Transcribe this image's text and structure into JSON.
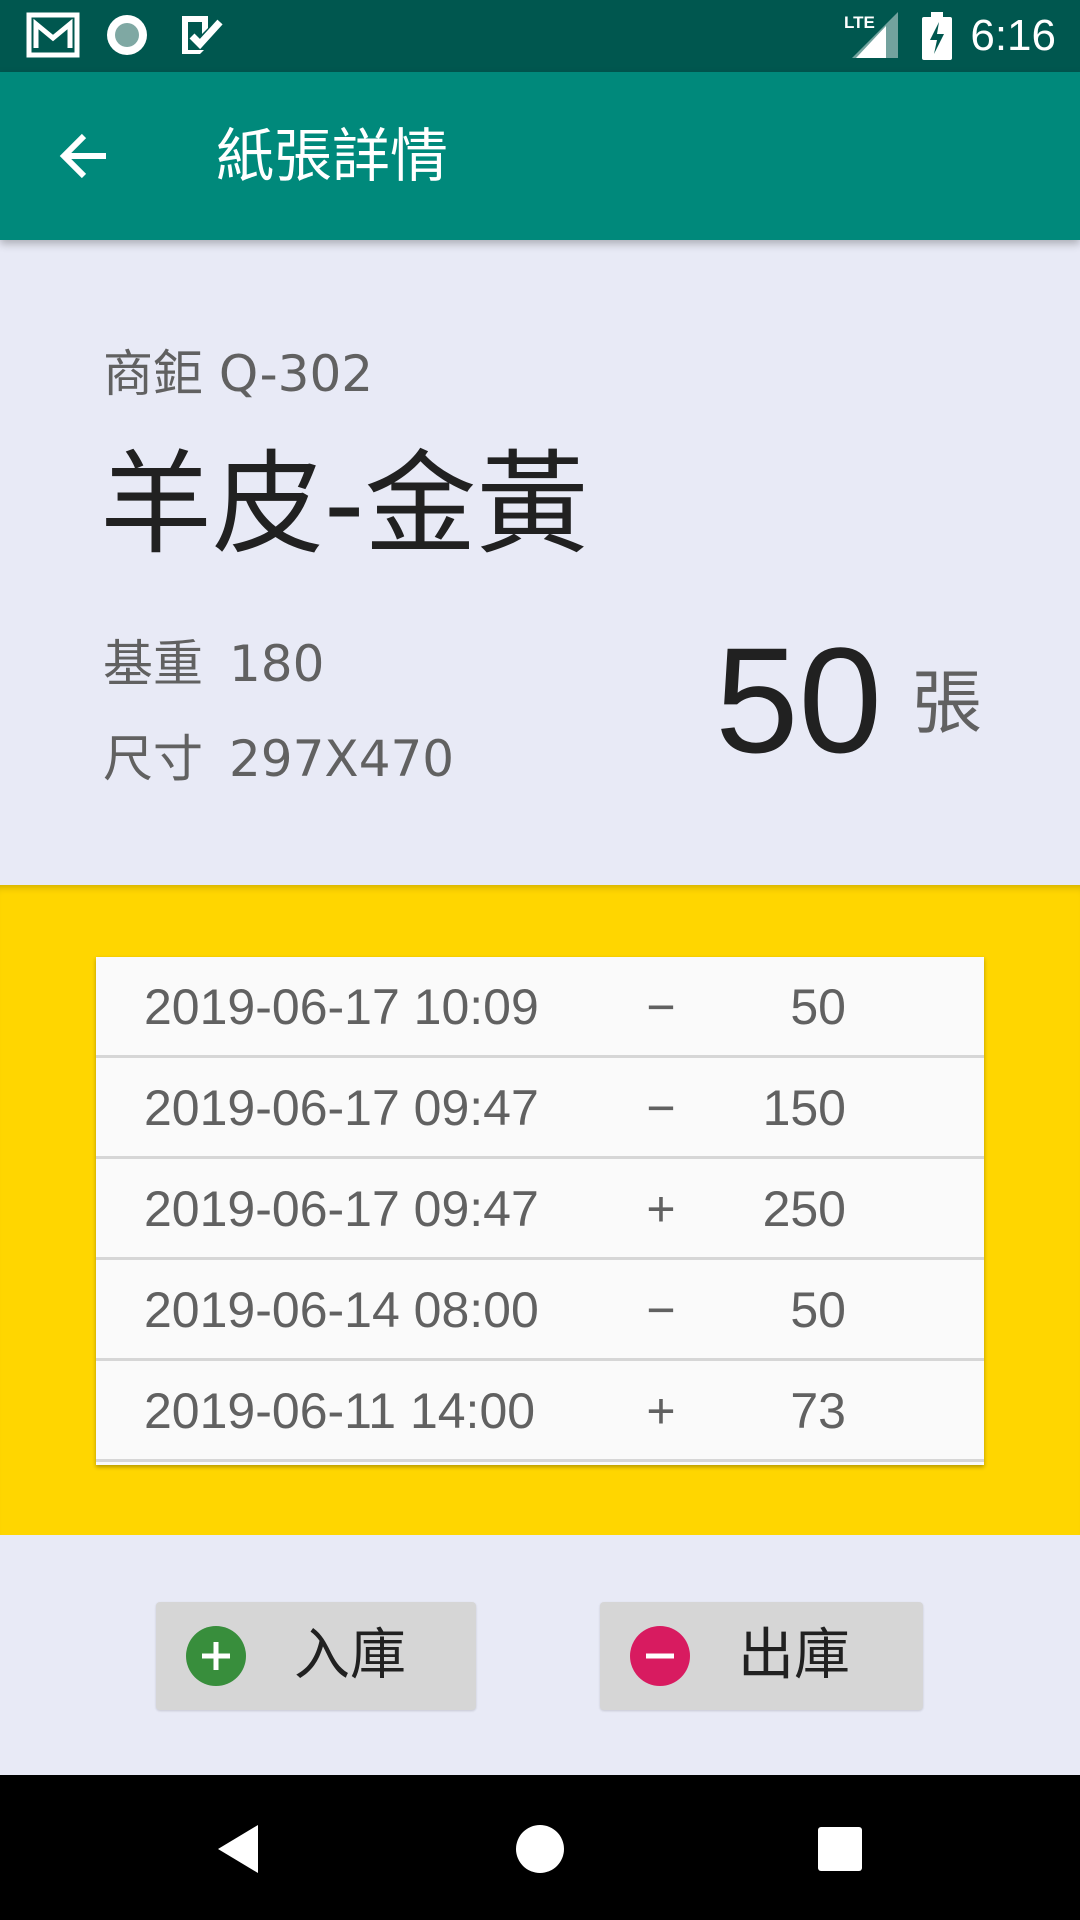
{
  "status_bar": {
    "time": "6:16",
    "network_label": "LTE",
    "icons": [
      "gmail-icon",
      "circle-app-icon",
      "checkmark-app-icon",
      "lte-signal-icon",
      "battery-charging-icon"
    ]
  },
  "app_bar": {
    "title": "紙張詳情",
    "back_icon": "arrow-left-icon"
  },
  "summary": {
    "supplier_code": "商鉅 Q-302",
    "paper_name": "羊皮-金黃",
    "weight_label": "基重",
    "weight_value": "180",
    "size_label": "尺寸",
    "size_value": "297X470",
    "stock_count": "50",
    "stock_unit": "張"
  },
  "history": {
    "rows": [
      {
        "date": "2019-06-17 10:09",
        "sign": "−",
        "qty": "50"
      },
      {
        "date": "2019-06-17 09:47",
        "sign": "−",
        "qty": "150"
      },
      {
        "date": "2019-06-17 09:47",
        "sign": "+",
        "qty": "250"
      },
      {
        "date": "2019-06-14 08:00",
        "sign": "−",
        "qty": "50"
      },
      {
        "date": "2019-06-11 14:00",
        "sign": "+",
        "qty": "73"
      }
    ]
  },
  "actions": {
    "stock_in_label": "入庫",
    "stock_out_label": "出庫",
    "stock_in_color": "#388E3C",
    "stock_out_color": "#D81B60"
  },
  "colors": {
    "status_bar": "#00574F",
    "app_bar": "#00897B",
    "background": "#E8EAF6",
    "history_background": "#FFD600"
  },
  "nav_bar": {
    "icons": [
      "back-triangle-icon",
      "home-circle-icon",
      "recents-square-icon"
    ]
  }
}
